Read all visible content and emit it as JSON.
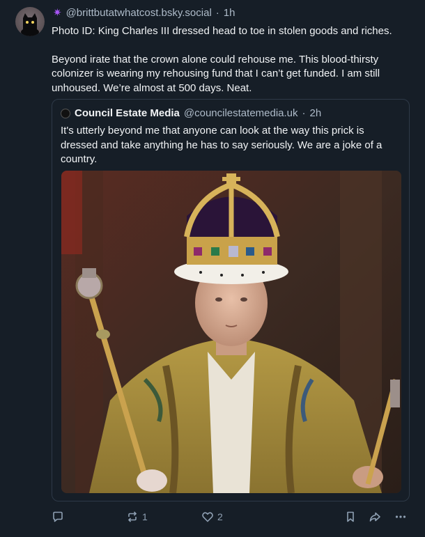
{
  "post": {
    "author_handle": "@brittbutatwhatcost.bsky.social",
    "separator": "·",
    "time": "1h",
    "paragraphs": [
      "Photo ID: King Charles III dressed head to toe in stolen goods and riches.",
      "Beyond irate that the crown alone could rehouse me. This blood-thirsty colonizer is wearing my rehousing fund that I can’t get funded. I am still unhoused. We’re almost at 500 days. Neat."
    ]
  },
  "quote": {
    "name": "Council Estate Media",
    "handle": "@councilestatemedia.uk",
    "separator": "·",
    "time": "2h",
    "text": "It's utterly beyond me that anyone can look at the way this prick is dressed and take anything he has to say seriously. We are a joke of a country."
  },
  "actions": {
    "reply_count": "",
    "repost_count": "1",
    "like_count": "2"
  },
  "colors": {
    "background": "#161e27",
    "text": "#f1f3f5",
    "muted": "#aebbc9",
    "icon": "#8fa0b3",
    "border": "#2e3a48",
    "sparkle": "#a855f7"
  },
  "icons": [
    "cat-avatar-icon",
    "sparkle-icon",
    "reply-icon",
    "repost-icon",
    "like-icon",
    "bookmark-icon",
    "share-icon",
    "more-icon"
  ]
}
